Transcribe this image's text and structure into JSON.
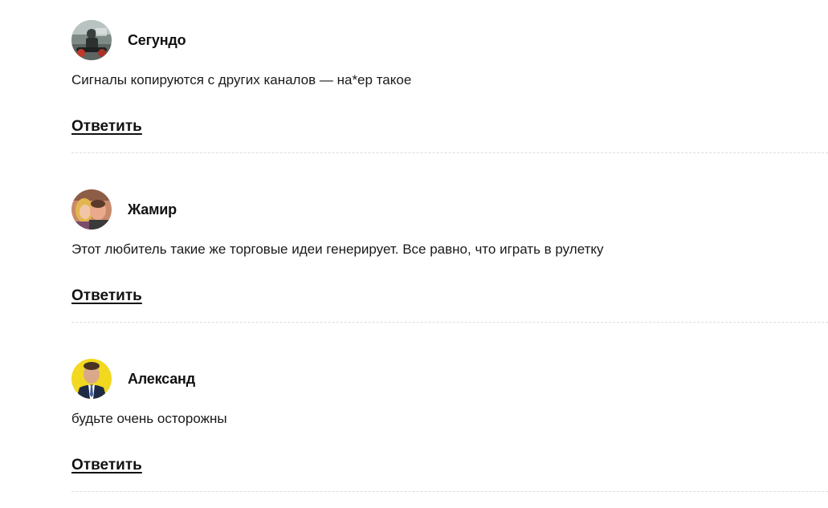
{
  "comments": [
    {
      "author": "Сегундо",
      "avatar": "avatar-photo-man-on-bike",
      "text": "Сигналы копируются с других каналов — на*ер такое",
      "reply_label": "Ответить"
    },
    {
      "author": "Жамир",
      "avatar": "avatar-photo-couple",
      "text": "Этот любитель такие же торговые идеи генерирует. Все равно, что играть в рулетку",
      "reply_label": "Ответить"
    },
    {
      "author": "Александ",
      "avatar": "avatar-photo-man-in-suit-yellow-bg",
      "text": "будьте очень осторожны",
      "reply_label": "Ответить"
    }
  ]
}
